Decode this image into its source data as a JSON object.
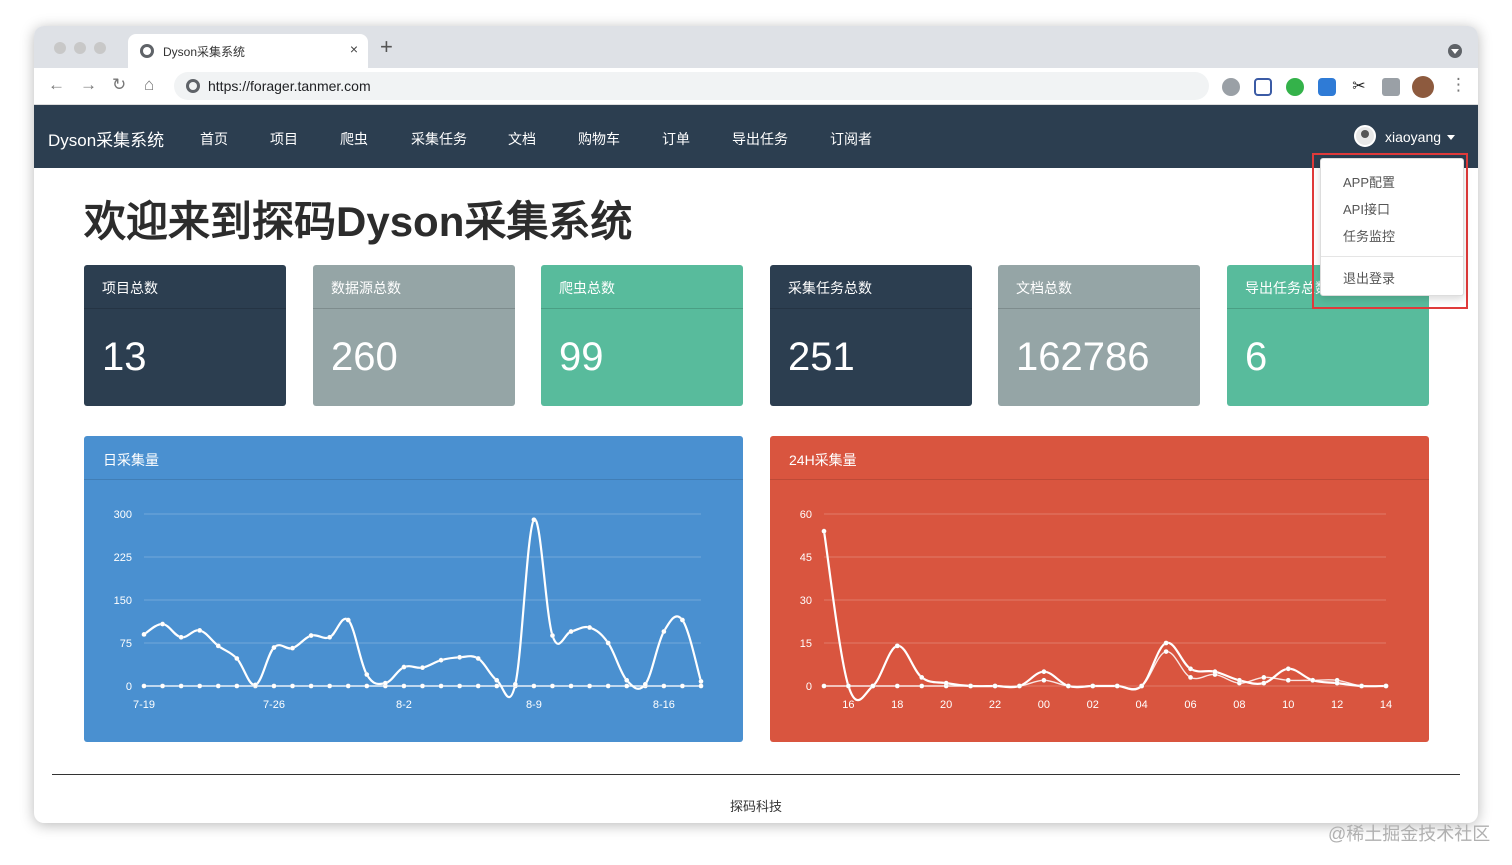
{
  "browser": {
    "tab_title": "Dyson采集系统",
    "tab_close": "×",
    "new_tab": "+",
    "url": "https://forager.tanmer.com",
    "back": "←",
    "forward": "→",
    "reload": "↻",
    "home": "⌂",
    "menu": "⋮"
  },
  "appnav": {
    "brand": "Dyson采集系统",
    "items": [
      "首页",
      "项目",
      "爬虫",
      "采集任务",
      "文档",
      "购物车",
      "订单",
      "导出任务",
      "订阅者"
    ],
    "user": "xiaoyang"
  },
  "dropdown": {
    "items": [
      "APP配置",
      "API接口",
      "任务监控"
    ],
    "logout": "退出登录"
  },
  "main": {
    "title": "欢迎来到探码Dyson采集系统"
  },
  "cards": [
    {
      "label": "项目总数",
      "value": "13"
    },
    {
      "label": "数据源总数",
      "value": "260"
    },
    {
      "label": "爬虫总数",
      "value": "99"
    },
    {
      "label": "采集任务总数",
      "value": "251"
    },
    {
      "label": "文档总数",
      "value": "162786"
    },
    {
      "label": "导出任务总数",
      "value": "6"
    }
  ],
  "colors": {
    "nav": "#2c3e50",
    "card_dark": "#2c3e50",
    "card_gray": "#95a5a6",
    "card_green": "#58bb9c",
    "chart_blue": "#4a90d0",
    "chart_red": "#d9553f",
    "highlight": "#e03a3a"
  },
  "chart_data": [
    {
      "type": "line",
      "title": "日采集量",
      "x": [
        "7-19",
        "7-20",
        "7-21",
        "7-22",
        "7-23",
        "7-24",
        "7-25",
        "7-26",
        "7-27",
        "7-28",
        "7-29",
        "7-30",
        "7-31",
        "8-1",
        "8-2",
        "8-3",
        "8-4",
        "8-5",
        "8-6",
        "8-7",
        "8-8",
        "8-9",
        "8-10",
        "8-11",
        "8-12",
        "8-13",
        "8-14",
        "8-15",
        "8-16",
        "8-17",
        "8-18"
      ],
      "xticks": [
        "7-19",
        "7-26",
        "8-2",
        "8-9",
        "8-16"
      ],
      "ylim": [
        0,
        300
      ],
      "yticks": [
        0,
        75,
        150,
        225,
        300
      ],
      "series": [
        {
          "values": [
            90,
            108,
            85,
            97,
            70,
            48,
            2,
            67,
            66,
            88,
            85,
            115,
            20,
            5,
            33,
            32,
            45,
            50,
            48,
            10,
            3,
            290,
            88,
            95,
            102,
            75,
            10,
            3,
            95,
            115,
            8
          ]
        },
        {
          "values": [
            0,
            0,
            0,
            0,
            0,
            0,
            0,
            0,
            0,
            0,
            0,
            0,
            0,
            0,
            0,
            0,
            0,
            0,
            0,
            0,
            0,
            0,
            0,
            0,
            0,
            0,
            0,
            0,
            0,
            0,
            0
          ]
        }
      ]
    },
    {
      "type": "line",
      "title": "24H采集量",
      "x": [
        "15",
        "16",
        "17",
        "18",
        "19",
        "20",
        "21",
        "22",
        "23",
        "00",
        "01",
        "02",
        "03",
        "04",
        "05",
        "06",
        "07",
        "08",
        "09",
        "10",
        "11",
        "12",
        "13",
        "14"
      ],
      "xticks": [
        "16",
        "18",
        "20",
        "22",
        "00",
        "02",
        "04",
        "06",
        "08",
        "10",
        "12",
        "14"
      ],
      "ylim": [
        0,
        60
      ],
      "yticks": [
        0,
        15,
        30,
        45,
        60
      ],
      "series": [
        {
          "values": [
            54,
            0,
            0,
            14,
            3,
            1,
            0,
            0,
            0,
            5,
            0,
            0,
            0,
            0,
            15,
            6,
            5,
            2,
            1,
            6,
            2,
            1,
            0,
            0
          ]
        },
        {
          "values": [
            0,
            0,
            0,
            0,
            0,
            0,
            0,
            0,
            0,
            2,
            0,
            0,
            0,
            0,
            12,
            3,
            4,
            1,
            3,
            2,
            2,
            2,
            0,
            0
          ]
        }
      ]
    }
  ],
  "footer": "探码科技",
  "watermark": "@稀土掘金技术社区"
}
